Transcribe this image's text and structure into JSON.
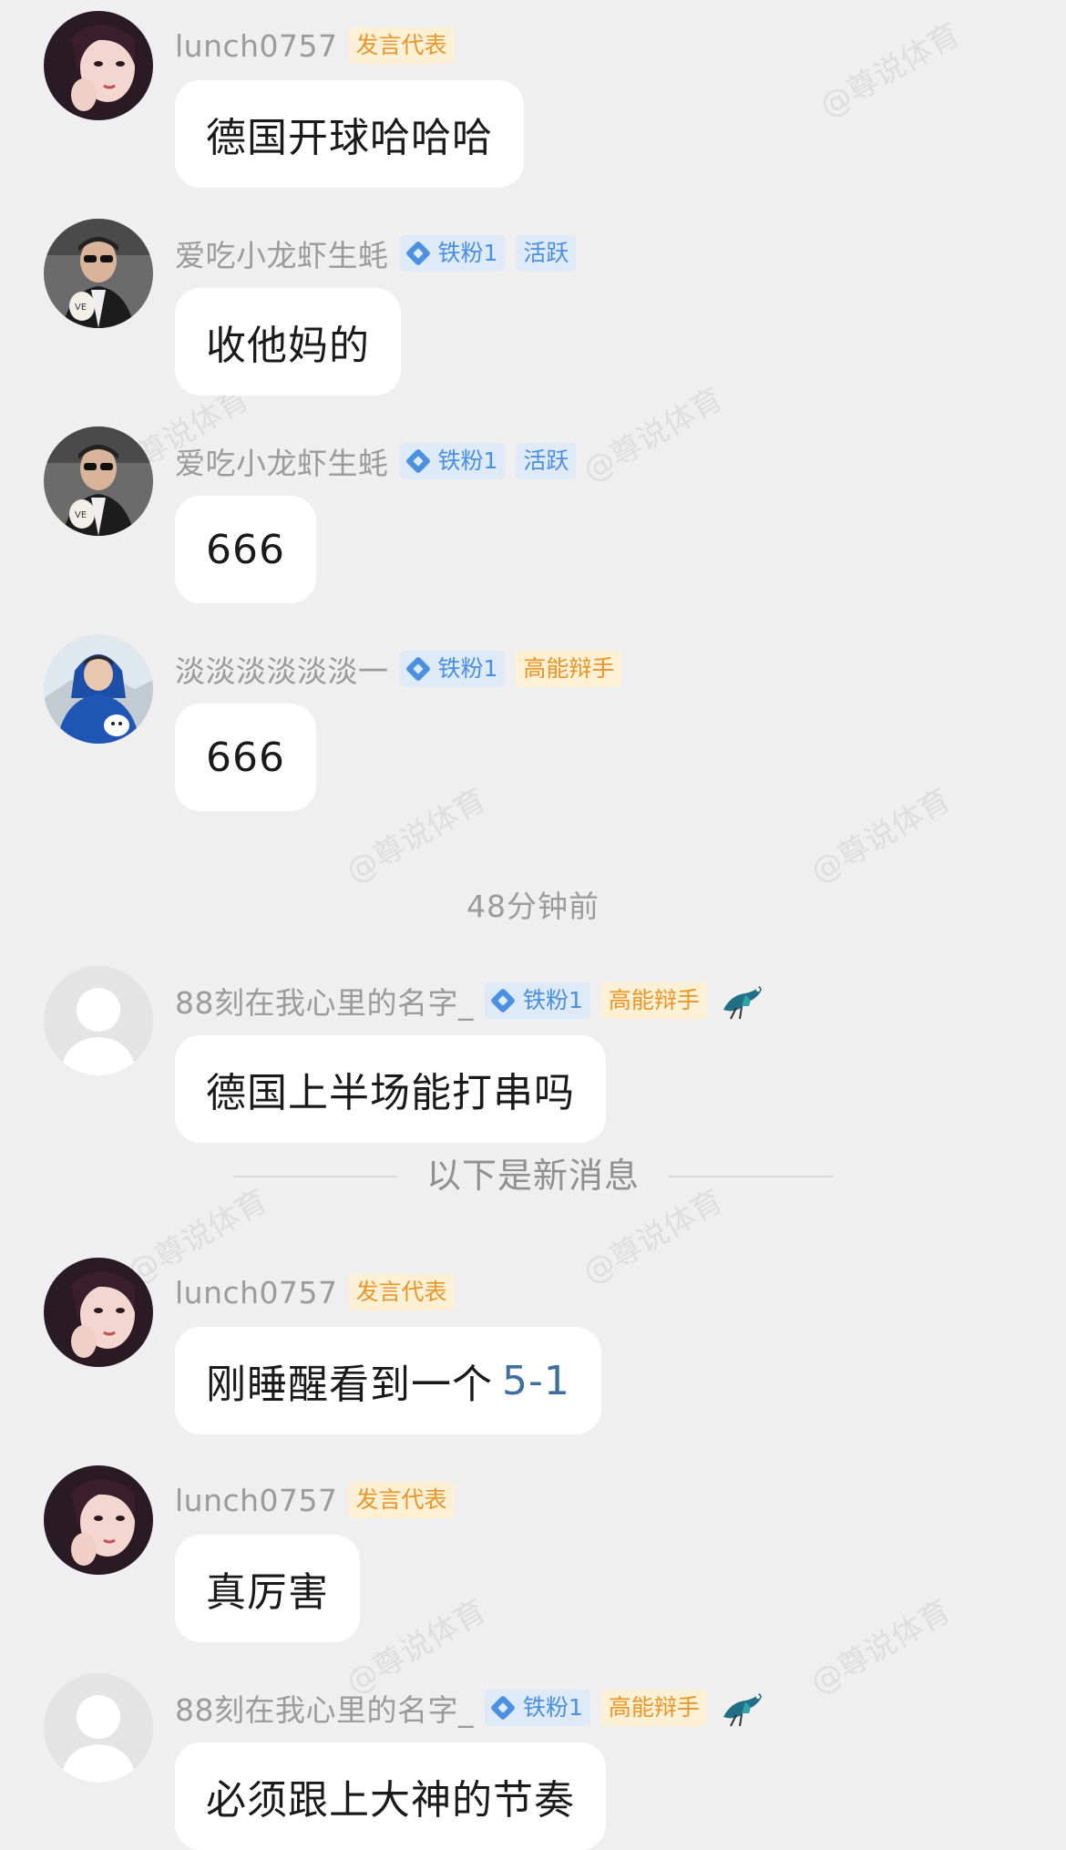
{
  "watermark": "@尊说体育",
  "messages": [
    {
      "username": "lunch0757",
      "badges": [
        "发言代表"
      ],
      "text": "德国开球哈哈哈"
    },
    {
      "username": "爱吃小龙虾生蚝",
      "badges": [
        "铁粉1",
        "活跃"
      ],
      "text": "收他妈的"
    },
    {
      "username": "爱吃小龙虾生蚝",
      "badges": [
        "铁粉1",
        "活跃"
      ],
      "text": "666"
    },
    {
      "username": "淡淡淡淡淡淡一",
      "badges": [
        "铁粉1",
        "高能辩手"
      ],
      "text": "666"
    },
    {
      "username": "88刻在我心里的名字_",
      "badges": [
        "铁粉1",
        "高能辩手"
      ],
      "text": "德国上半场能打串吗"
    },
    {
      "username": "lunch0757",
      "badges": [
        "发言代表"
      ],
      "text": "刚睡醒看到一个",
      "score": "5-1"
    },
    {
      "username": "lunch0757",
      "badges": [
        "发言代表"
      ],
      "text": "真厉害"
    },
    {
      "username": "88刻在我心里的名字_",
      "badges": [
        "铁粉1",
        "高能辩手"
      ],
      "text": "必须跟上大神的节奏"
    }
  ],
  "timestamp": "48分钟前",
  "new_messages_divider": "以下是新消息",
  "colors": {
    "background": "#efefef",
    "bubble": "#ffffff",
    "badge_orange": "#e8962a",
    "badge_blue": "#4a8fe0",
    "score_link": "#3f6f9e"
  },
  "icons": {
    "fan_badge": "diamond-icon",
    "achievement": "magpie-bird-icon"
  }
}
